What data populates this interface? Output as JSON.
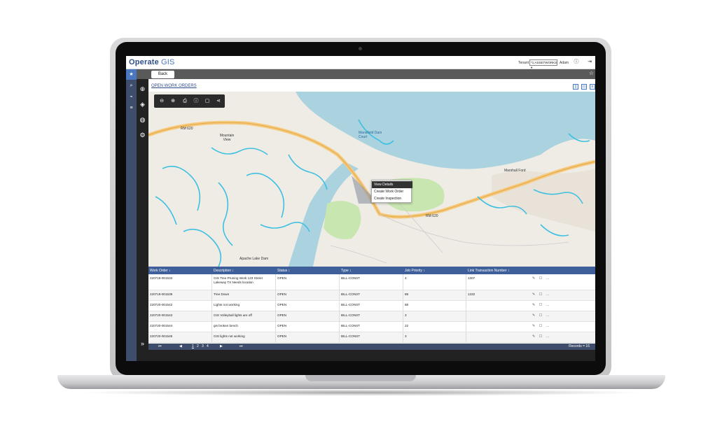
{
  "app": {
    "brand": "Operate",
    "product": "GIS"
  },
  "header": {
    "tenant_label": "Tenant",
    "tenant_value": "*1:ASSETWORKS",
    "user": "Adam",
    "info_icon": "info-icon",
    "logout_icon": "logout-icon"
  },
  "toolbar": {
    "back_label": "Back"
  },
  "page": {
    "link": "OPEN WORK ORDERS"
  },
  "map": {
    "labels": [
      "RM 620",
      "Mountain View",
      "Apache Lake Dam",
      "RM 620",
      "Mansfield Dam Court",
      "Marshall Ford"
    ],
    "context_menu": [
      "View Details",
      "Create Work Order",
      "Create Inspection"
    ]
  },
  "table": {
    "columns": [
      "Work Order ↕",
      "Description ↕",
      "Status ↕",
      "Type ↕",
      "Job Priority ↕",
      "Link Transaction Number ↕"
    ],
    "rows": [
      {
        "wo": "220719-001532",
        "desc": "GIS Tree Pruning Work 123 Street Lakeway TX Needs location",
        "status": "OPEN",
        "type": "BILL-CONST",
        "priority": "4",
        "link": "1307"
      },
      {
        "wo": "220719-001539",
        "desc": "Tree Down",
        "status": "OPEN",
        "type": "BILL-CONST",
        "priority": "88",
        "link": "1332"
      },
      {
        "wo": "220720-001542",
        "desc": "Lights not working",
        "status": "OPEN",
        "type": "BILL-CONST",
        "priority": "88",
        "link": ""
      },
      {
        "wo": "220720-001543",
        "desc": "GIS Volleyball lights are off",
        "status": "OPEN",
        "type": "BILL-CONST",
        "priority": "3",
        "link": ""
      },
      {
        "wo": "220720-001544",
        "desc": "gis broken bench",
        "status": "OPEN",
        "type": "BILL-CONST",
        "priority": "22",
        "link": ""
      },
      {
        "wo": "220720-001545",
        "desc": "GIS lights not working",
        "status": "OPEN",
        "type": "BILL-CONST",
        "priority": "3",
        "link": ""
      }
    ],
    "row_icons": "✎ ☐ …"
  },
  "pager": {
    "pages": [
      "1",
      "2",
      "3",
      "4"
    ],
    "records": "Records = 16"
  },
  "colors": {
    "brand": "#2f4f8a",
    "accent": "#4a78c0",
    "water": "#aad3df",
    "park": "#c8e6b0",
    "road": "#f7c97a",
    "pipe": "#3fc0e0"
  }
}
